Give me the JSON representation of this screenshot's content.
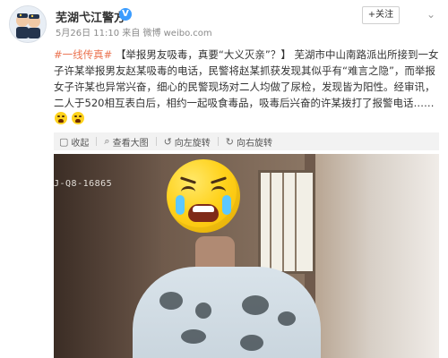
{
  "header": {
    "account_name": "芜湖弋江警方",
    "verified_badge": "V",
    "meta": "5月26日 11:10 来自 微博 weibo.com",
    "follow_label": "+关注",
    "chevron": "⌄"
  },
  "post": {
    "hashtag": "#一线传真#",
    "highlight": "【举报男友吸毒，真要“大义灭亲”？】",
    "body": "芜湖市中山南路派出所接到一女子许某举报男友赵某吸毒的电话，民警将赵某抓获发现其似乎有“难言之隐”，而举报女子许某也异常兴奋，细心的民警现场对二人均做了尿检，发现皆为阳性。经审讯，二人于520相互表白后，相约一起吸食毒品，吸毒后兴奋的许某拨打了报警电话……"
  },
  "toolbar": {
    "collapse": "收起",
    "view_large": "查看大图",
    "rotate_left": "向左旋转",
    "rotate_right": "向右旋转"
  },
  "photo": {
    "code_overlay": "J-Q8-16865"
  },
  "colors": {
    "hashtag": "#eb7350",
    "verified": "#3b9cff",
    "follow_plus": "#ff8200"
  },
  "icons": {
    "avatar": "police-avatar",
    "verified": "verified-icon",
    "chevron": "chevron-down-icon",
    "collapse": "collapse-icon",
    "view_large": "zoom-icon",
    "rotate_left": "rotate-left-icon",
    "rotate_right": "rotate-right-icon",
    "emoji": "crying-emoji-icon"
  }
}
